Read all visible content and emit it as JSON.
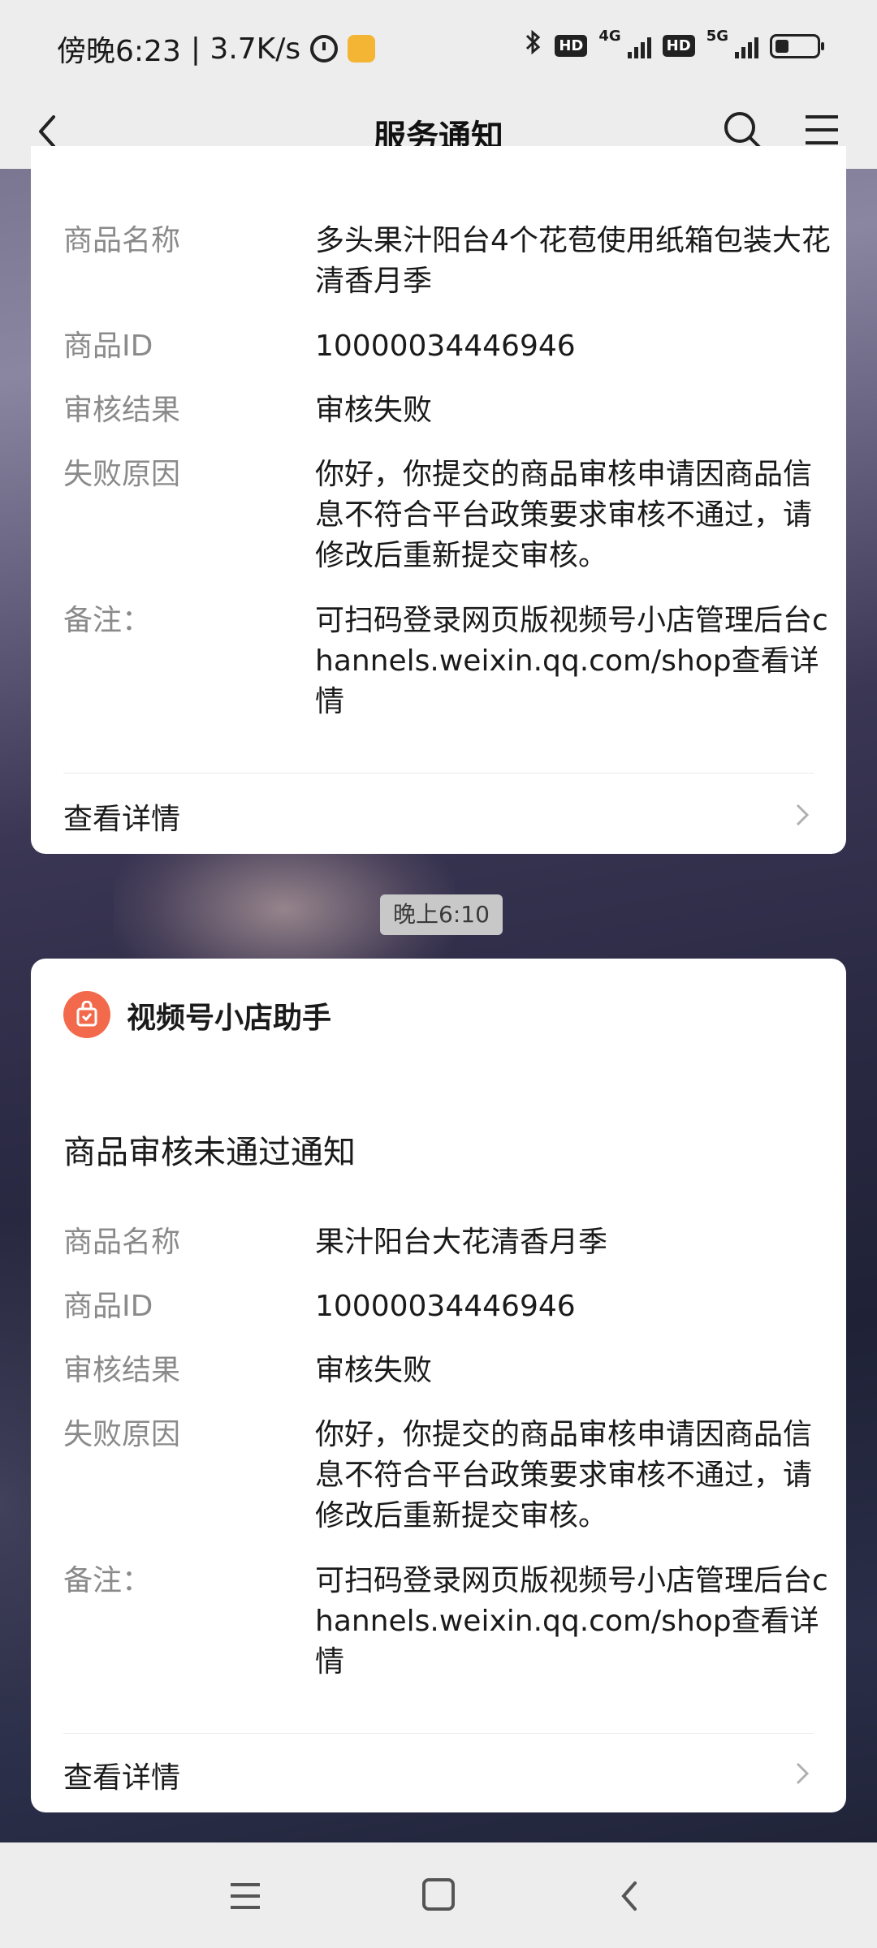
{
  "status_bar": {
    "time": "傍晚6:23",
    "net_speed": "| 3.7K/s",
    "hd1": "HD",
    "net1": "4G",
    "hd2": "HD",
    "net2": "5G",
    "icons": [
      "alarm-icon",
      "app-badge-icon",
      "bluetooth-icon",
      "signal-icon",
      "battery-icon"
    ]
  },
  "nav": {
    "title": "服务通知"
  },
  "card1": {
    "rows": [
      {
        "label": "商品名称",
        "value": "多头果汁阳台4个花苞使用纸箱包装大花清香月季"
      },
      {
        "label": "商品ID",
        "value": "10000034446946"
      },
      {
        "label": "审核结果",
        "value": "审核失败"
      },
      {
        "label": "失败原因",
        "value": "你好，你提交的商品审核申请因商品信息不符合平台政策要求审核不通过，请修改后重新提交审核。"
      },
      {
        "label": "备注：",
        "value": "可扫码登录网页版视频号小店管理后台channels.weixin.qq.com/shop查看详情"
      }
    ],
    "detail_link": "查看详情"
  },
  "timestamp": "晚上6:10",
  "card2": {
    "sender": "视频号小店助手",
    "title": "商品审核未通过通知",
    "rows": [
      {
        "label": "商品名称",
        "value": "果汁阳台大花清香月季"
      },
      {
        "label": "商品ID",
        "value": "10000034446946"
      },
      {
        "label": "审核结果",
        "value": "审核失败"
      },
      {
        "label": "失败原因",
        "value": "你好，你提交的商品审核申请因商品信息不符合平台政策要求审核不通过，请修改后重新提交审核。"
      },
      {
        "label": "备注：",
        "value": "可扫码登录网页版视频号小店管理后台channels.weixin.qq.com/shop查看详情"
      }
    ],
    "detail_link": "查看详情"
  },
  "colors": {
    "shop_icon": "#f26a4b",
    "bar_bg": "#ededed"
  }
}
